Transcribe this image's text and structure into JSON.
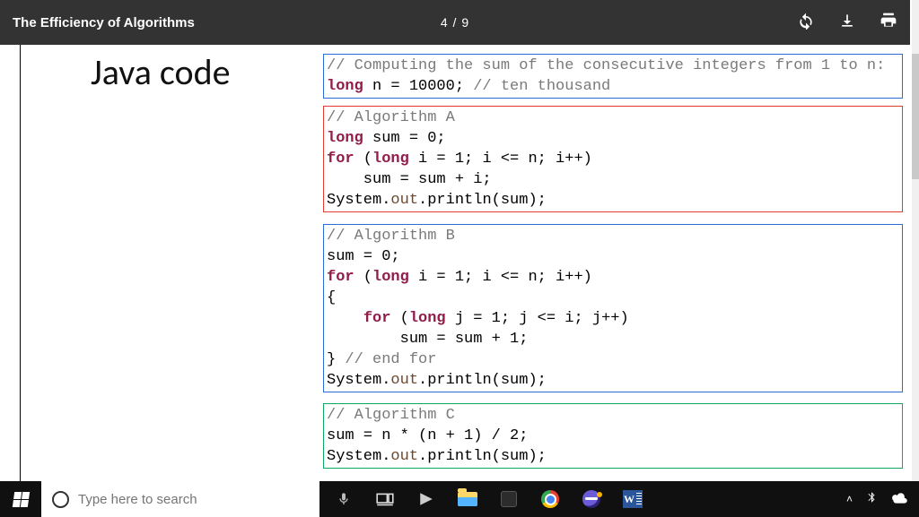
{
  "viewer": {
    "title": "The Efficiency of Algorithms",
    "page_indicator": "4 / 9"
  },
  "slide": {
    "heading": "Java code",
    "block1": {
      "l1_comment": "// Computing the sum of the consecutive integers from 1 to n:",
      "l2_kw": "long",
      "l2_rest_a": " n = 10000; ",
      "l2_comment": "// ten thousand"
    },
    "block2": {
      "l1_comment": "// Algorithm A",
      "l2_kw": "long",
      "l2_rest": " sum = 0;",
      "l3_kw1": "for",
      "l3_a": " (",
      "l3_kw2": "long",
      "l3_b": " i = 1; i <= n; i++)",
      "l4": "    sum = sum + i;",
      "l5_a": "System.",
      "l5_id": "out",
      "l5_b": ".println(sum);"
    },
    "block3": {
      "l1_comment": "// Algorithm B",
      "l2": "sum = 0;",
      "l3_kw1": "for",
      "l3_a": " (",
      "l3_kw2": "long",
      "l3_b": " i = 1; i <= n; i++)",
      "l4": "{",
      "l5_pre": "    ",
      "l5_kw1": "for",
      "l5_a": " (",
      "l5_kw2": "long",
      "l5_b": " j = 1; j <= i; j++)",
      "l6": "        sum = sum + 1;",
      "l7_a": "} ",
      "l7_comment": "// end for",
      "l8_a": "System.",
      "l8_id": "out",
      "l8_b": ".println(sum);"
    },
    "block4": {
      "l1_comment": "// Algorithm C",
      "l2": "sum = n * (n + 1) / 2;",
      "l3_a": "System.",
      "l3_id": "out",
      "l3_b": ".println(sum);"
    }
  },
  "taskbar": {
    "search_placeholder": "Type here to search",
    "word_letter": "W"
  }
}
